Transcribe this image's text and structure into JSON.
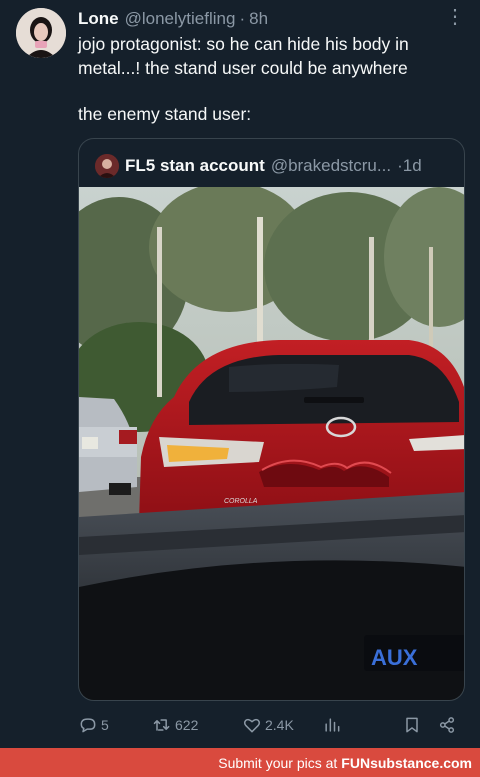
{
  "tweet": {
    "name": "Lone",
    "handle": "@lonelytiefling",
    "dot": "·",
    "time": "8h",
    "more": "⋮",
    "text_line1": "jojo protagonist: so he can hide his body in metal...! the stand user could be anywhere",
    "text_line2": "the enemy stand user:"
  },
  "quote": {
    "name": "FL5 stan account",
    "handle": "@brakedstcru...",
    "dot": "·",
    "time": "1d",
    "photo_text": {
      "badge": "COROLLA",
      "aux": "AUX"
    }
  },
  "actions": {
    "replies": "5",
    "retweets": "622",
    "likes": "2.4K"
  },
  "icons": [
    "reply-icon",
    "retweet-icon",
    "like-icon",
    "views-icon",
    "bookmark-icon",
    "share-icon"
  ],
  "footer": {
    "prefix": "Submit your pics at",
    "site": "FUNsubstance.com"
  },
  "colors": {
    "background": "#15202b",
    "muted": "#8b98a5",
    "footer": "#d94a3e"
  }
}
